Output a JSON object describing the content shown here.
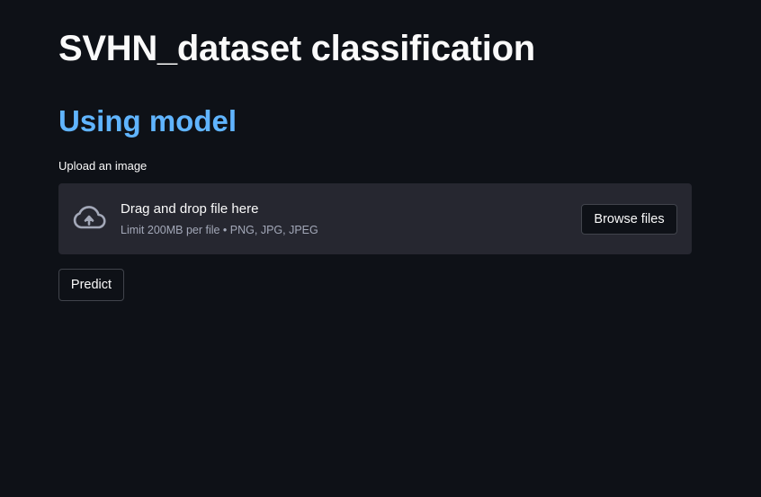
{
  "page": {
    "title": "SVHN_dataset classification",
    "subtitle": "Using model"
  },
  "uploader": {
    "label": "Upload an image",
    "icon": "cloud-upload-icon",
    "dropzone_text": "Drag and drop file here",
    "limit_text": "Limit 200MB per file • PNG, JPG, JPEG",
    "browse_label": "Browse files"
  },
  "actions": {
    "predict_label": "Predict"
  },
  "colors": {
    "background": "#0e1117",
    "dropzone": "#262730",
    "subtitle": "#60b4ff",
    "text": "#fafafa",
    "muted_text": "#a3a8b8",
    "button_border": "#41444c"
  }
}
